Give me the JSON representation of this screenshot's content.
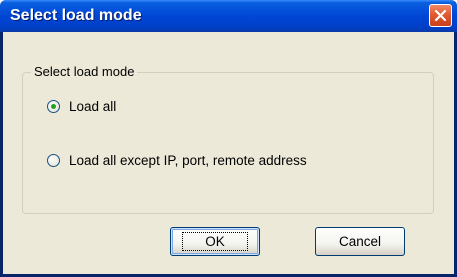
{
  "window": {
    "title": "Select load mode",
    "close_icon": "close-icon"
  },
  "group": {
    "label": "Select load mode",
    "options": [
      {
        "label": "Load all",
        "checked": true
      },
      {
        "label": "Load all except IP, port, remote address",
        "checked": false
      }
    ]
  },
  "buttons": {
    "ok_label": "OK",
    "cancel_label": "Cancel"
  },
  "colors": {
    "titlebar": "#0046d6",
    "close_button": "#e35a30",
    "dialog_face": "#ece9d8",
    "radio_dot": "#21a121"
  }
}
